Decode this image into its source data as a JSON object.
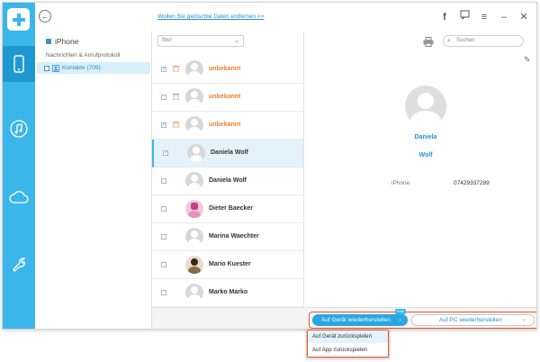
{
  "topbar": {
    "link": "Wollen Sie gelöschte Daten entfernen >>",
    "icons": [
      "facebook-icon",
      "feedback-icon",
      "menu-icon",
      "minimize-icon",
      "close-icon"
    ]
  },
  "sidebar": {
    "icons": [
      "logo-plus-icon",
      "phone-icon",
      "music-icon",
      "cloud-icon",
      "wrench-icon"
    ]
  },
  "tree": {
    "device": "iPhone",
    "section": "Nachrichten & Anrufprotokoll",
    "item": "Kontakte (709)"
  },
  "list": {
    "filter": "filter",
    "contacts": [
      {
        "name": "unbekannt",
        "checked": true,
        "deleted": true
      },
      {
        "name": "unbekannt",
        "checked": false,
        "deleted": true
      },
      {
        "name": "unbekannt",
        "checked": true,
        "deleted": true
      },
      {
        "name": "Daniela Wolf",
        "checked": true,
        "deleted": false
      },
      {
        "name": "Daniela Wolf",
        "checked": false,
        "deleted": false
      },
      {
        "name": "Dieter Baecker",
        "checked": false,
        "deleted": false
      },
      {
        "name": "Marina Waechter",
        "checked": false,
        "deleted": false
      },
      {
        "name": "Mario Kuester",
        "checked": false,
        "deleted": false
      },
      {
        "name": "Marko Marko",
        "checked": false,
        "deleted": false
      }
    ]
  },
  "detail": {
    "search_placeholder": "Suchen",
    "first_name": "Daniela",
    "last_name": "Wolf",
    "phone_label": "iPhone",
    "phone_value": "07429337289"
  },
  "bottom": {
    "primary_label": "Auf Gerät wiederherstellen",
    "badge": "Free",
    "secondary_label": "Auf PC wiederherstellen"
  },
  "dropdown": {
    "items": [
      "Auf Gerät zurückspielen",
      "Auf App zurückspielen"
    ]
  },
  "colors": {
    "accent": "#3bb6ea",
    "highlight": "#e8572a",
    "unknown_name": "#f08030"
  }
}
